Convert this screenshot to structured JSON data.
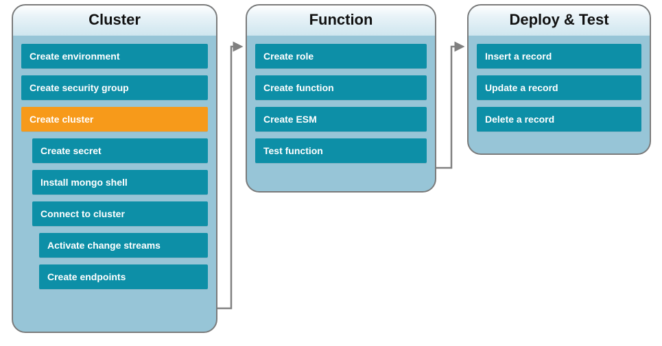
{
  "diagram": {
    "panels": [
      {
        "id": "cluster",
        "title": "Cluster",
        "items": [
          {
            "label": "Create environment",
            "indent": 0,
            "highlight": false
          },
          {
            "label": "Create security group",
            "indent": 0,
            "highlight": false
          },
          {
            "label": "Create cluster",
            "indent": 0,
            "highlight": true
          },
          {
            "label": "Create secret",
            "indent": 1,
            "highlight": false
          },
          {
            "label": "Install mongo shell",
            "indent": 1,
            "highlight": false
          },
          {
            "label": "Connect to cluster",
            "indent": 1,
            "highlight": false
          },
          {
            "label": "Activate change streams",
            "indent": 2,
            "highlight": false
          },
          {
            "label": "Create endpoints",
            "indent": 2,
            "highlight": false
          }
        ]
      },
      {
        "id": "function",
        "title": "Function",
        "items": [
          {
            "label": "Create role",
            "indent": 0,
            "highlight": false
          },
          {
            "label": "Create function",
            "indent": 0,
            "highlight": false
          },
          {
            "label": "Create ESM",
            "indent": 0,
            "highlight": false
          },
          {
            "label": "Test function",
            "indent": 0,
            "highlight": false
          }
        ]
      },
      {
        "id": "deploy",
        "title": "Deploy & Test",
        "items": [
          {
            "label": "Insert a record",
            "indent": 0,
            "highlight": false
          },
          {
            "label": "Update a record",
            "indent": 0,
            "highlight": false
          },
          {
            "label": "Delete a record",
            "indent": 0,
            "highlight": false
          }
        ]
      }
    ],
    "colors": {
      "item_bg": "#0d8fa7",
      "item_highlight_bg": "#f79a1a",
      "panel_body_bg": "#97c5d7",
      "arrow": "#808080"
    }
  }
}
